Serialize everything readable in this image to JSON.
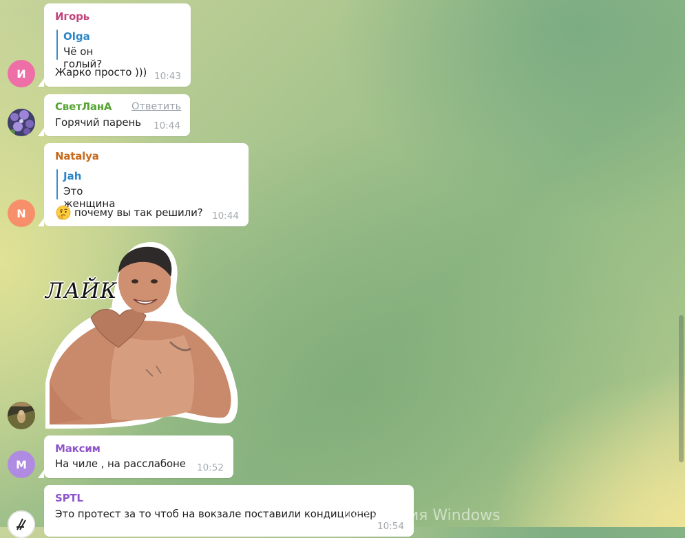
{
  "messages": [
    {
      "sender": "Игорь",
      "sender_color": "#c2457b",
      "avatar_letter": "И",
      "avatar_color": "#ee6fa8",
      "reply_to": {
        "name": "Olga",
        "text": "Чё он голый?"
      },
      "text": "Жарко просто )))",
      "time": "10:43"
    },
    {
      "sender": "СветЛанА",
      "sender_color": "#55a433",
      "avatar_icon": "flowers-photo-avatar",
      "reply_action": "Ответить",
      "text": "Горячий парень",
      "time": "10:44"
    },
    {
      "sender": "Natalya",
      "sender_color": "#c86a1d",
      "avatar_letter": "N",
      "avatar_color": "#f7906a",
      "reply_to": {
        "name": "Jah",
        "text": "Это женщина"
      },
      "emoji_icon": "thinking-face-emoji",
      "text": "почему вы так решили?",
      "time": "10:44"
    },
    {
      "type": "sticker",
      "avatar_icon": "painting-photo-avatar",
      "sticker_caption": "ЛАЙК",
      "sticker_icon": "man-heart-hands-sticker"
    },
    {
      "sender": "Максим",
      "sender_color": "#8e55c8",
      "avatar_letter": "M",
      "avatar_color": "#b08be2",
      "text": "На чиле , на расслабоне",
      "time": "10:52"
    },
    {
      "sender": "SPTL",
      "sender_color": "#8e55c8",
      "avatar_icon": "logo-avatar",
      "text": "Это протест за то чтоб на вокзале поставили кондиционер",
      "time": "10:54"
    }
  ],
  "watermark": "Активация Windows"
}
